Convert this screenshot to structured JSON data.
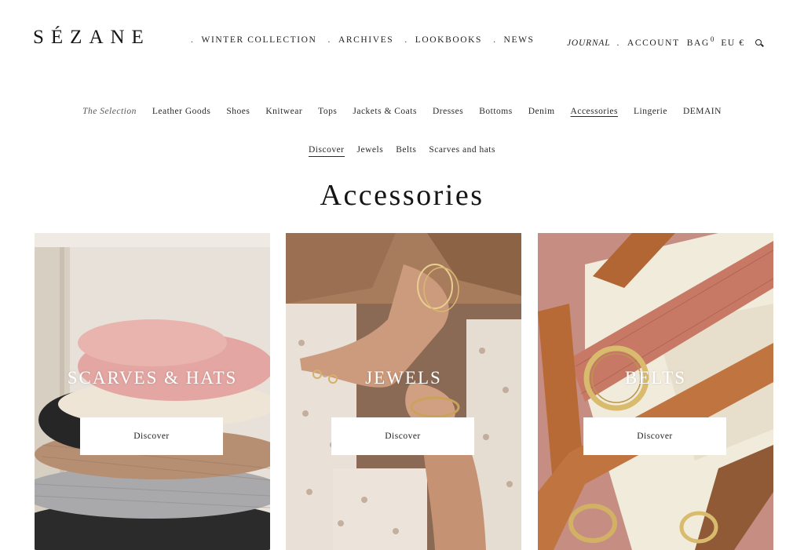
{
  "header": {
    "logo": "SÉZANE",
    "nav": [
      {
        "label": "WINTER COLLECTION"
      },
      {
        "label": "ARCHIVES"
      },
      {
        "label": "LOOKBOOKS"
      },
      {
        "label": "NEWS"
      }
    ],
    "separator": ".",
    "journal": "JOURNAL",
    "account": "ACCOUNT",
    "bag": "BAG",
    "bag_count": "0",
    "currency": "EU €",
    "search_icon": "search-icon"
  },
  "categories": [
    {
      "label": "The Selection",
      "style": "italic"
    },
    {
      "label": "Leather Goods"
    },
    {
      "label": "Shoes"
    },
    {
      "label": "Knitwear"
    },
    {
      "label": "Tops"
    },
    {
      "label": "Jackets & Coats"
    },
    {
      "label": "Dresses"
    },
    {
      "label": "Bottoms"
    },
    {
      "label": "Denim"
    },
    {
      "label": "Accessories",
      "active": true
    },
    {
      "label": "Lingerie"
    },
    {
      "label": "DEMAIN"
    }
  ],
  "subcategories": [
    {
      "label": "Discover",
      "active": true
    },
    {
      "label": "Jewels"
    },
    {
      "label": "Belts"
    },
    {
      "label": "Scarves and hats"
    }
  ],
  "page_title": "Accessories",
  "tiles": [
    {
      "label": "SCARVES & HATS",
      "button": "Discover"
    },
    {
      "label": "JEWELS",
      "button": "Discover"
    },
    {
      "label": "BELTS",
      "button": "Discover"
    }
  ],
  "colors": {
    "text": "#1f1f1f",
    "background": "#ffffff",
    "button_bg": "#ffffff"
  }
}
